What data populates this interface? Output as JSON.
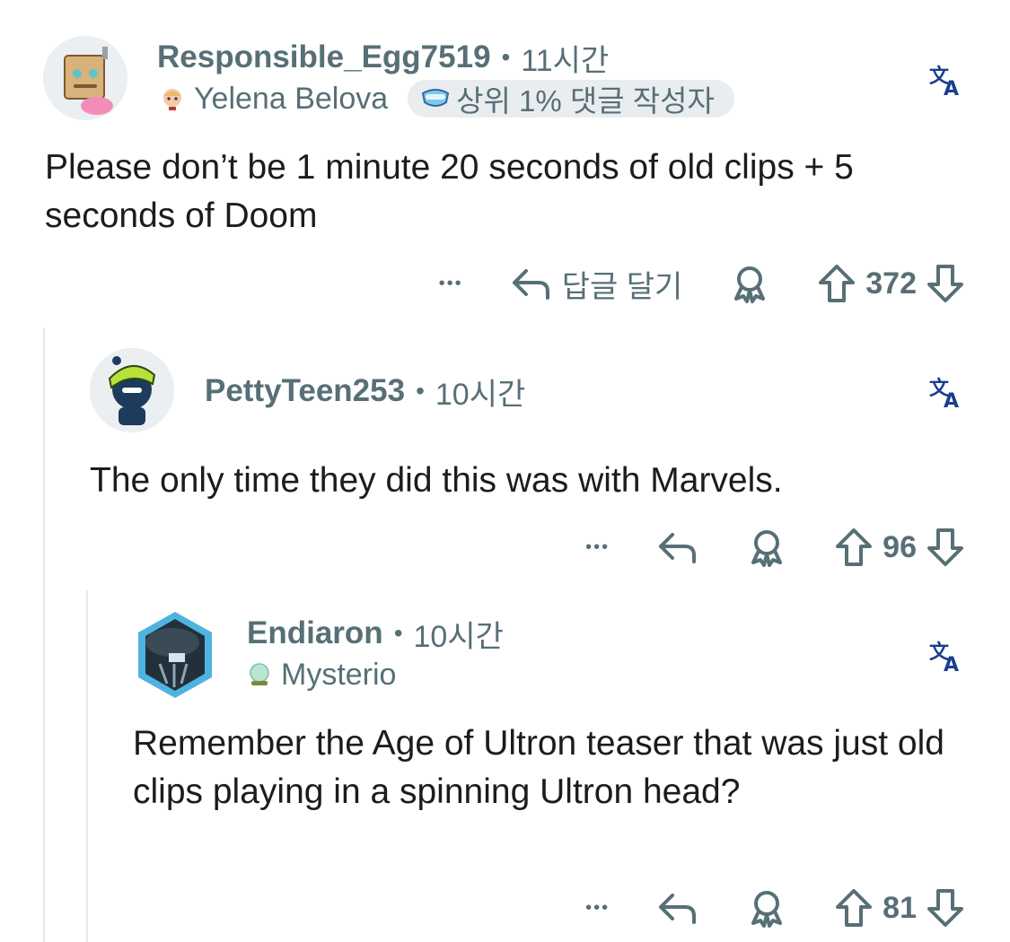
{
  "thread": {
    "comment1": {
      "username": "Responsible_Egg7519",
      "separator": "•",
      "time": "11시간",
      "flair": "Yelena Belova",
      "badge": "상위 1% 댓글 작성자",
      "body": "Please don’t be 1 minute 20 seconds of old clips + 5 seconds of Doom",
      "more": "•••",
      "reply_label": "답글 달기",
      "score": "372"
    },
    "comment2": {
      "username": "PettyTeen253",
      "separator": "•",
      "time": "10시간",
      "body": "The only time they did this was with Marvels.",
      "more": "•••",
      "score": "96"
    },
    "comment3": {
      "username": "Endiaron",
      "separator": "•",
      "time": "10시간",
      "flair": "Mysterio",
      "body": "Remember the Age of Ultron teaser that was just old clips playing in a spinning Ultron head?",
      "more": "•••",
      "score": "81"
    }
  },
  "icons": [
    "translate-icon",
    "reply-icon",
    "award-icon",
    "upvote-icon",
    "downvote-icon",
    "more-icon"
  ],
  "colors": {
    "meta_gray": "#576f76",
    "text": "#1c1c1c",
    "thread_line": "#e4e6e8",
    "badge_bg": "#eaedef"
  }
}
